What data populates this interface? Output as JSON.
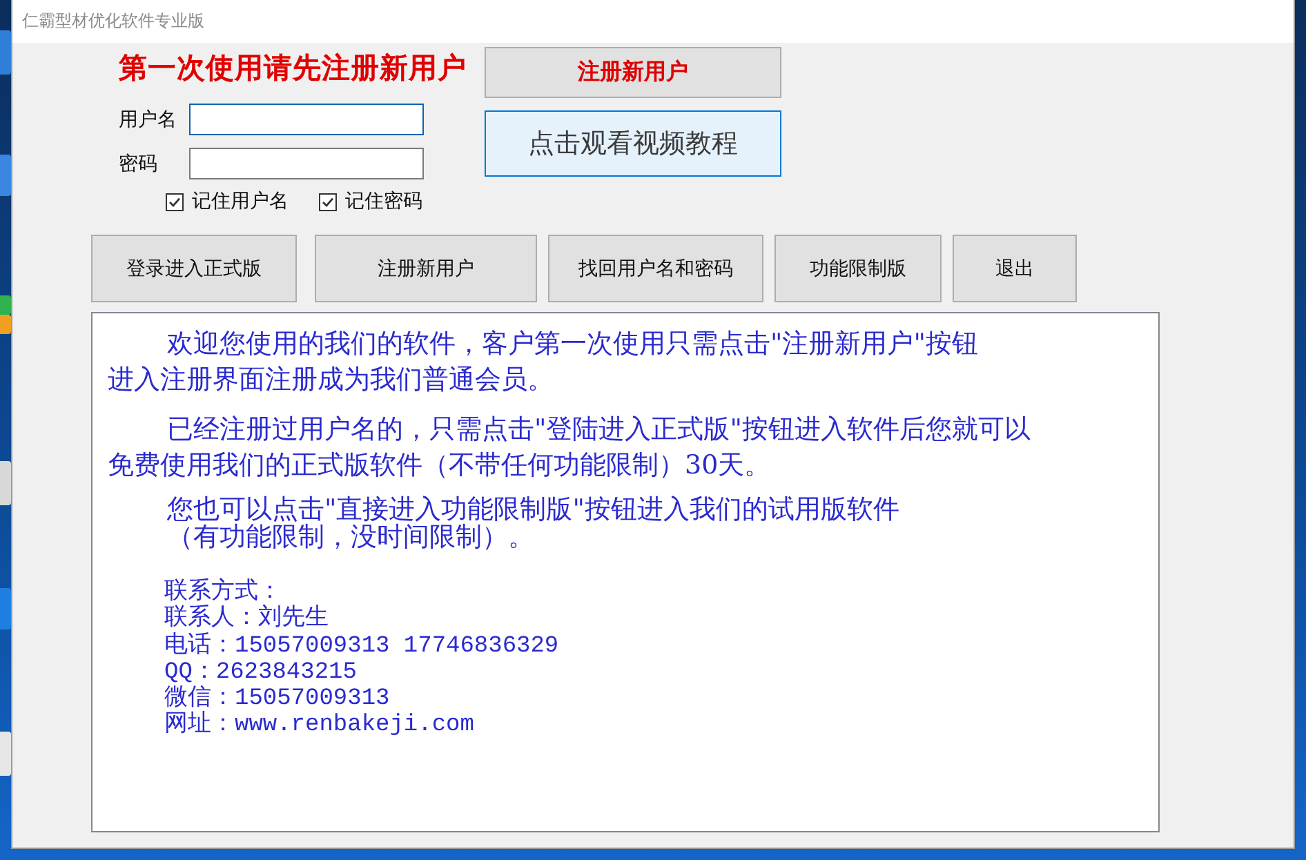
{
  "window": {
    "title": "仁霸型材优化软件专业版"
  },
  "login": {
    "heading": "第一次使用请先注册新用户",
    "fields": [
      {
        "label": "用户名",
        "focused": true
      },
      {
        "label": "密码",
        "focused": false
      }
    ],
    "checkboxes": [
      {
        "label": "记住用户名",
        "checked": true
      },
      {
        "label": "记住密码",
        "checked": true
      }
    ]
  },
  "side_buttons": [
    {
      "label": "注册新用户",
      "kind": "alert"
    },
    {
      "label": "点击观看视频教程",
      "kind": "link"
    }
  ],
  "action_buttons": [
    "登录进入正式版",
    "注册新用户",
    "找回用户名和密码",
    "功能限制版",
    "退出"
  ],
  "notice": {
    "paragraphs": [
      {
        "lines": [
          {
            "text": "欢迎您使用的我们的软件，客户第一次使用只需点击\"注册新用户\"按钮",
            "indented": true
          },
          {
            "text": "进入注册界面注册成为我们普通会员。",
            "indented": false
          }
        ]
      },
      {
        "lines": [
          {
            "text": "已经注册过用户名的，只需点击\"登陆进入正式版\"按钮进入软件后您就可以",
            "indented": true
          },
          {
            "text": "免费使用我们的正式版软件（不带任何功能限制）30天。",
            "indented": false
          }
        ]
      },
      {
        "lines": [
          {
            "text": "您也可以点击\"直接进入功能限制版\"按钮进入我们的试用版软件",
            "indented": true
          },
          {
            "text": "（有功能限制，没时间限制）。",
            "indented": true
          }
        ]
      }
    ],
    "contact": [
      "联系方式：",
      "联系人：刘先生",
      "电话：15057009313 17746836329",
      "QQ：2623843215",
      "微信：15057009313",
      "网址：www.renbakeji.com"
    ]
  }
}
